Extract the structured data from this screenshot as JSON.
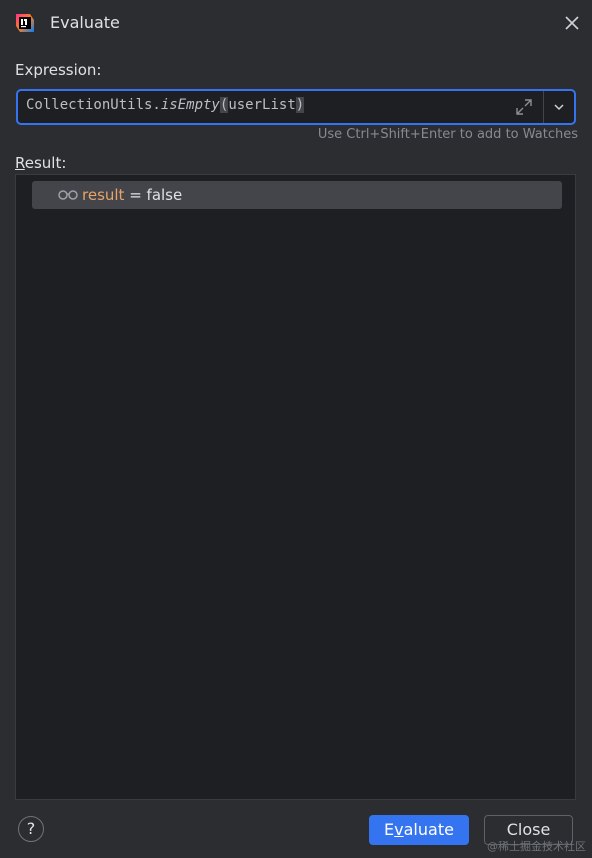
{
  "window": {
    "title": "Evaluate",
    "app_icon": "intellij-idea-icon",
    "close_icon": "close-icon"
  },
  "expression": {
    "label_first": "E",
    "label_rest": "xpression:",
    "value_prefix": "CollectionUtils.",
    "value_method": "isEmpty",
    "value_open_paren": "(",
    "value_arg": "userList",
    "value_close_paren": ")",
    "expand_icon": "expand-icon",
    "dropdown_icon": "chevron-down-icon",
    "hint": "Use Ctrl+Shift+Enter to add to Watches"
  },
  "result": {
    "label_first": "R",
    "label_rest": "esult:",
    "row_icon": "glasses-icon",
    "name": "result",
    "equals": " = ",
    "value": "false"
  },
  "footer": {
    "help_label": "?",
    "evaluate_first": "E",
    "evaluate_mnemonic": "v",
    "evaluate_rest": "aluate",
    "close_label": "Close"
  },
  "watermark": "@稀土掘金技术社区",
  "colors": {
    "background": "#2b2d30",
    "accent": "#3574f0",
    "result_name": "#e8a368"
  }
}
